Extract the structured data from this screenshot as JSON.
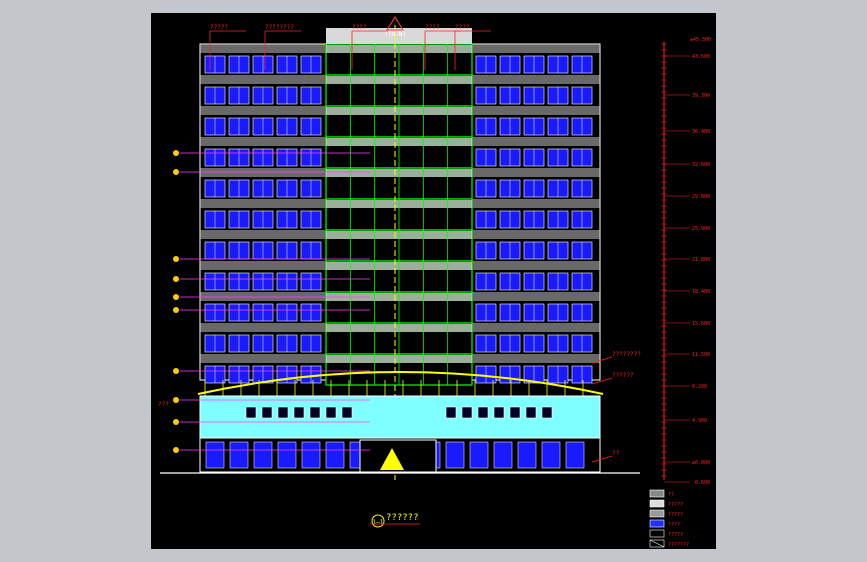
{
  "drawing": {
    "title_label": "??????",
    "title_symbol": "1–1",
    "top_axis": "?(N-N)",
    "bottom_axis_mark": "±",
    "callouts_top": [
      "?????",
      "????????",
      "????",
      "????",
      "????"
    ],
    "callouts_right": [
      "????????",
      "??????",
      "??"
    ],
    "callout_left": "???"
  },
  "elevation_scale": {
    "top_label": "±45.300",
    "levels": [
      "43.500",
      "39.300",
      "36.400",
      "32.600",
      "29.800",
      "25.900",
      "21.800",
      "18.400",
      "15.600",
      "11.500",
      "8.200",
      "4.900",
      "±0.000",
      "-0.600"
    ]
  },
  "legend": {
    "items": [
      {
        "label": "?? ",
        "pattern": "dots"
      },
      {
        "label": "?????",
        "pattern": "white"
      },
      {
        "label": "?????",
        "pattern": "gray"
      },
      {
        "label": "????",
        "pattern": "blue"
      },
      {
        "label": "?????",
        "pattern": "frame"
      },
      {
        "label": "???????",
        "pattern": "hatch"
      }
    ]
  },
  "colors": {
    "background": "#000000",
    "window_blue": "#1a1aff",
    "grid_green": "#00ff00",
    "cyan_wall": "#7fffff",
    "leader_red": "#ff2020",
    "leader_magenta": "#ff40ff",
    "dome_yellow": "#ffff00"
  }
}
